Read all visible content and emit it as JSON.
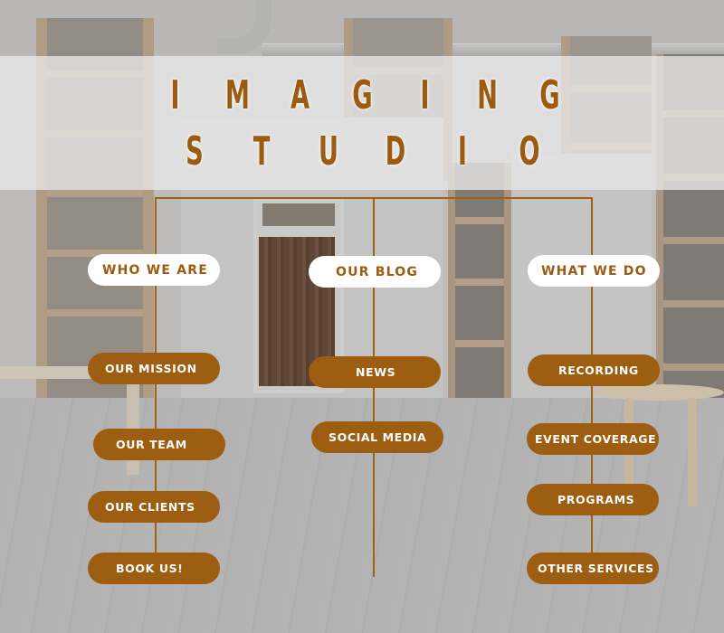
{
  "title": {
    "line1": [
      "I",
      "M",
      "A",
      "G",
      "I",
      "N",
      "G"
    ],
    "line2": [
      "S",
      "T",
      "U",
      "D",
      "I",
      "O"
    ],
    "color": "#9b5c12"
  },
  "colors": {
    "brand_brown": "#9e5e12",
    "header_pill_bg": "#ffffff",
    "sub_pill_text": "#ffffff"
  },
  "columns": [
    {
      "heading": "WHO WE ARE",
      "items": [
        "OUR MISSION",
        "OUR TEAM",
        "OUR CLIENTS",
        "BOOK US!"
      ]
    },
    {
      "heading": "OUR BLOG",
      "items": [
        "NEWS",
        "SOCIAL MEDIA"
      ]
    },
    {
      "heading": "WHAT WE DO",
      "items": [
        "RECORDING",
        "EVENT COVERAGE",
        "PROGRAMS",
        "OTHER SERVICES"
      ]
    }
  ]
}
